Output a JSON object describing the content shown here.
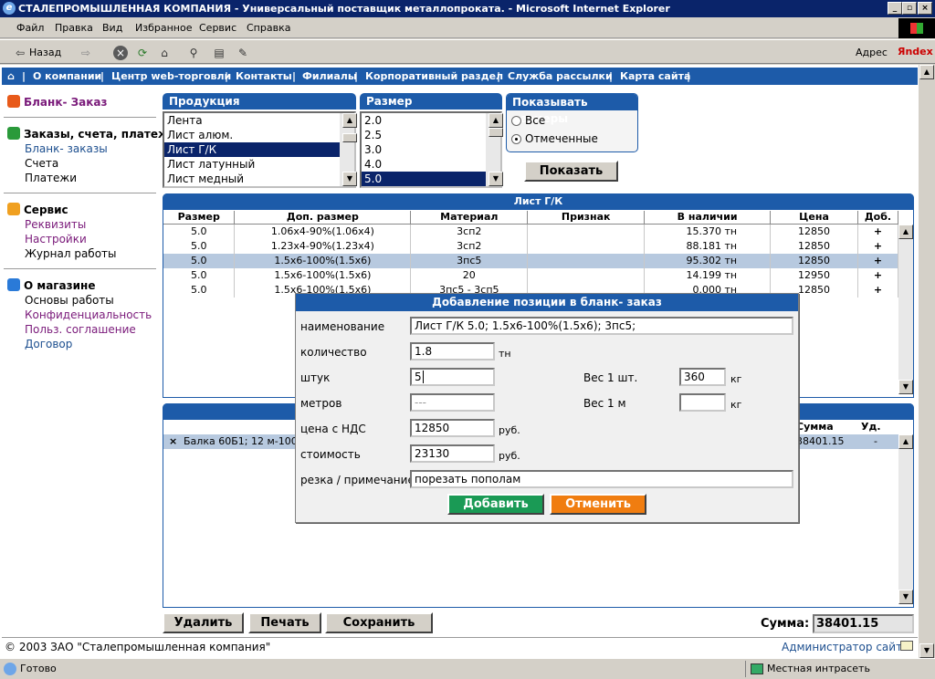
{
  "window": {
    "title": "СТАЛЕПРОМЫШЛЕННАЯ КОМПАНИЯ - Универсальный поставщик металлопроката. - Microsoft Internet Explorer"
  },
  "menu": [
    "Файл",
    "Правка",
    "Вид",
    "Избранное",
    "Сервис",
    "Справка"
  ],
  "toolbar": {
    "back": "Назад",
    "address": "Адрес",
    "yandex": "Яndex"
  },
  "navbar": [
    "|",
    "О компании",
    "|",
    "Центр web-торговли",
    "|",
    "Контакты",
    "|",
    "Филиалы",
    "|",
    "Корпоративный раздел",
    "|",
    "Служба рассылки",
    "|",
    "Карта сайта",
    "|"
  ],
  "sidebar": {
    "blank_title": "Бланк- Заказ",
    "orders_title": "Заказы, счета, платежи",
    "orders_items": [
      "Бланк- заказы",
      "Счета",
      "Платежи"
    ],
    "service_title": "Сервис",
    "service_items": [
      "Реквизиты",
      "Настройки",
      "Журнал работы"
    ],
    "shop_title": "О магазине",
    "shop_items": [
      "Основы работы",
      "Конфиденциальность",
      "Польз. соглашение",
      "Договор"
    ]
  },
  "products": {
    "header": "Продукция",
    "items": [
      "Лента",
      "Лист алюм.",
      "Лист Г/К",
      "Лист латунный",
      "Лист медный"
    ],
    "selected": 2
  },
  "sizes": {
    "header": "Размер",
    "items": [
      "2.0",
      "2.5",
      "3.0",
      "4.0",
      "5.0"
    ],
    "selected": 4
  },
  "show_sizes": {
    "header": "Показывать размеры",
    "option_all": "Все",
    "option_marked": "Отмеченные",
    "selected": "marked"
  },
  "show_button": "Показать",
  "stock": {
    "title": "Лист Г/К",
    "columns": [
      "Размер",
      "Доп. размер",
      "Материал",
      "Признак",
      "В наличии",
      "Цена",
      "Доб."
    ],
    "rows": [
      [
        "5.0",
        "1.06x4-90%(1.06x4)",
        "3сп2",
        "",
        "15.370 тн",
        "12850",
        "+"
      ],
      [
        "5.0",
        "1.23x4-90%(1.23x4)",
        "3сп2",
        "",
        "88.181 тн",
        "12850",
        "+"
      ],
      [
        "5.0",
        "1.5x6-100%(1.5x6)",
        "3пс5",
        "",
        "95.302 тн",
        "12850",
        "+"
      ],
      [
        "5.0",
        "1.5x6-100%(1.5x6)",
        "20",
        "",
        "14.199 тн",
        "12950",
        "+"
      ],
      [
        "5.0",
        "1.5x6-100%(1.5x6)",
        "3пс5 - 3сп5",
        "",
        "0.000 тн",
        "12850",
        "+"
      ]
    ],
    "highlighted": 2
  },
  "order": {
    "col_sum": "Сумма",
    "col_del": "Уд.",
    "row": {
      "mark": "×",
      "name": "Балка 60Б1; 12 м-100",
      "sum": "38401.15",
      "del": "-"
    }
  },
  "dialog": {
    "title": "Добавление позиции в бланк- заказ",
    "name_label": "наименование",
    "name_value": "Лист Г/К 5.0; 1.5x6-100%(1.5x6); 3пс5;",
    "qty_label": "количество",
    "qty_value": "1.8",
    "qty_unit": "тн",
    "pcs_label": "штук",
    "pcs_value": "5",
    "w1_label": "Вес 1 шт.",
    "w1_value": "360",
    "w1_unit": "кг",
    "m_label": "метров",
    "m_value": "---",
    "wm_label": "Вес 1 м",
    "wm_value": "",
    "wm_unit": "кг",
    "price_label": "цена с НДС",
    "price_value": "12850",
    "price_unit": "руб.",
    "cost_label": "стоимость",
    "cost_value": "23130",
    "cost_unit": "руб.",
    "note_label": "резка / примечание",
    "note_value": "порезать пополам",
    "add_button": "Добавить",
    "cancel_button": "Отменить",
    "add_color": "#1a9a55",
    "cancel_color": "#f07d10"
  },
  "bottom": {
    "delete": "Удалить",
    "print": "Печать",
    "save": "Сохранить",
    "sum_label": "Сумма:",
    "sum_value": "38401.15"
  },
  "footer": {
    "copyright": "© 2003 ЗАО \"Сталепромышленная компания\"",
    "admin": "Администратор сайта"
  },
  "status": {
    "ready": "Готово",
    "zone": "Местная интрасеть"
  }
}
